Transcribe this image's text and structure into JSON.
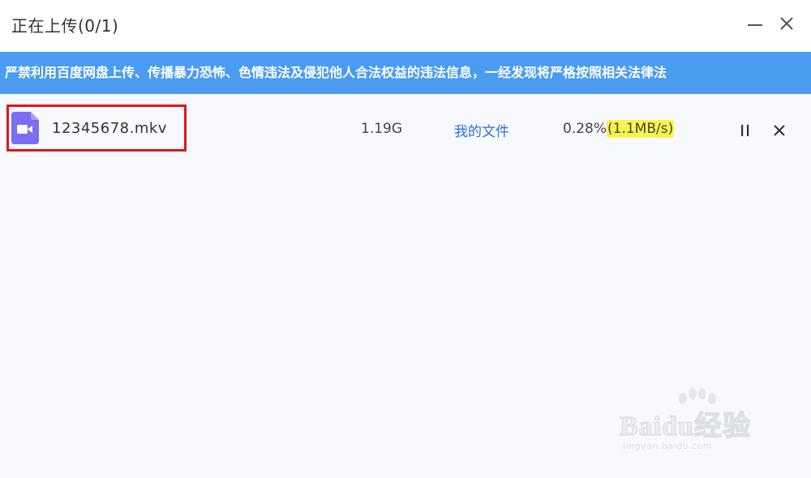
{
  "window": {
    "title": "正在上传(0/1)",
    "minimize_icon": "minimize-icon",
    "close_icon": "close-icon"
  },
  "notice": {
    "text": "严禁利用百度网盘上传、传播暴力恐怖、色情违法及侵犯他人合法权益的违法信息，一经发现将严格按照相关法律法"
  },
  "upload_list": [
    {
      "file_name": "12345678.mkv",
      "file_icon": "video-file-icon",
      "size": "1.19G",
      "destination": "我的文件",
      "progress_percent": "0.28%",
      "speed": "(1.1MB/s)",
      "pause_icon": "pause-icon",
      "cancel_icon": "cancel-icon"
    }
  ],
  "watermark": {
    "brand": "Baidu经验",
    "sub": "jingyan.baidu.com"
  },
  "colors": {
    "notice_bg": "#4a9cf0",
    "link": "#2a6fd6",
    "highlight_box": "#e3141c",
    "speed_highlight": "#f8f54a",
    "video_icon": "#7b6cf0"
  }
}
